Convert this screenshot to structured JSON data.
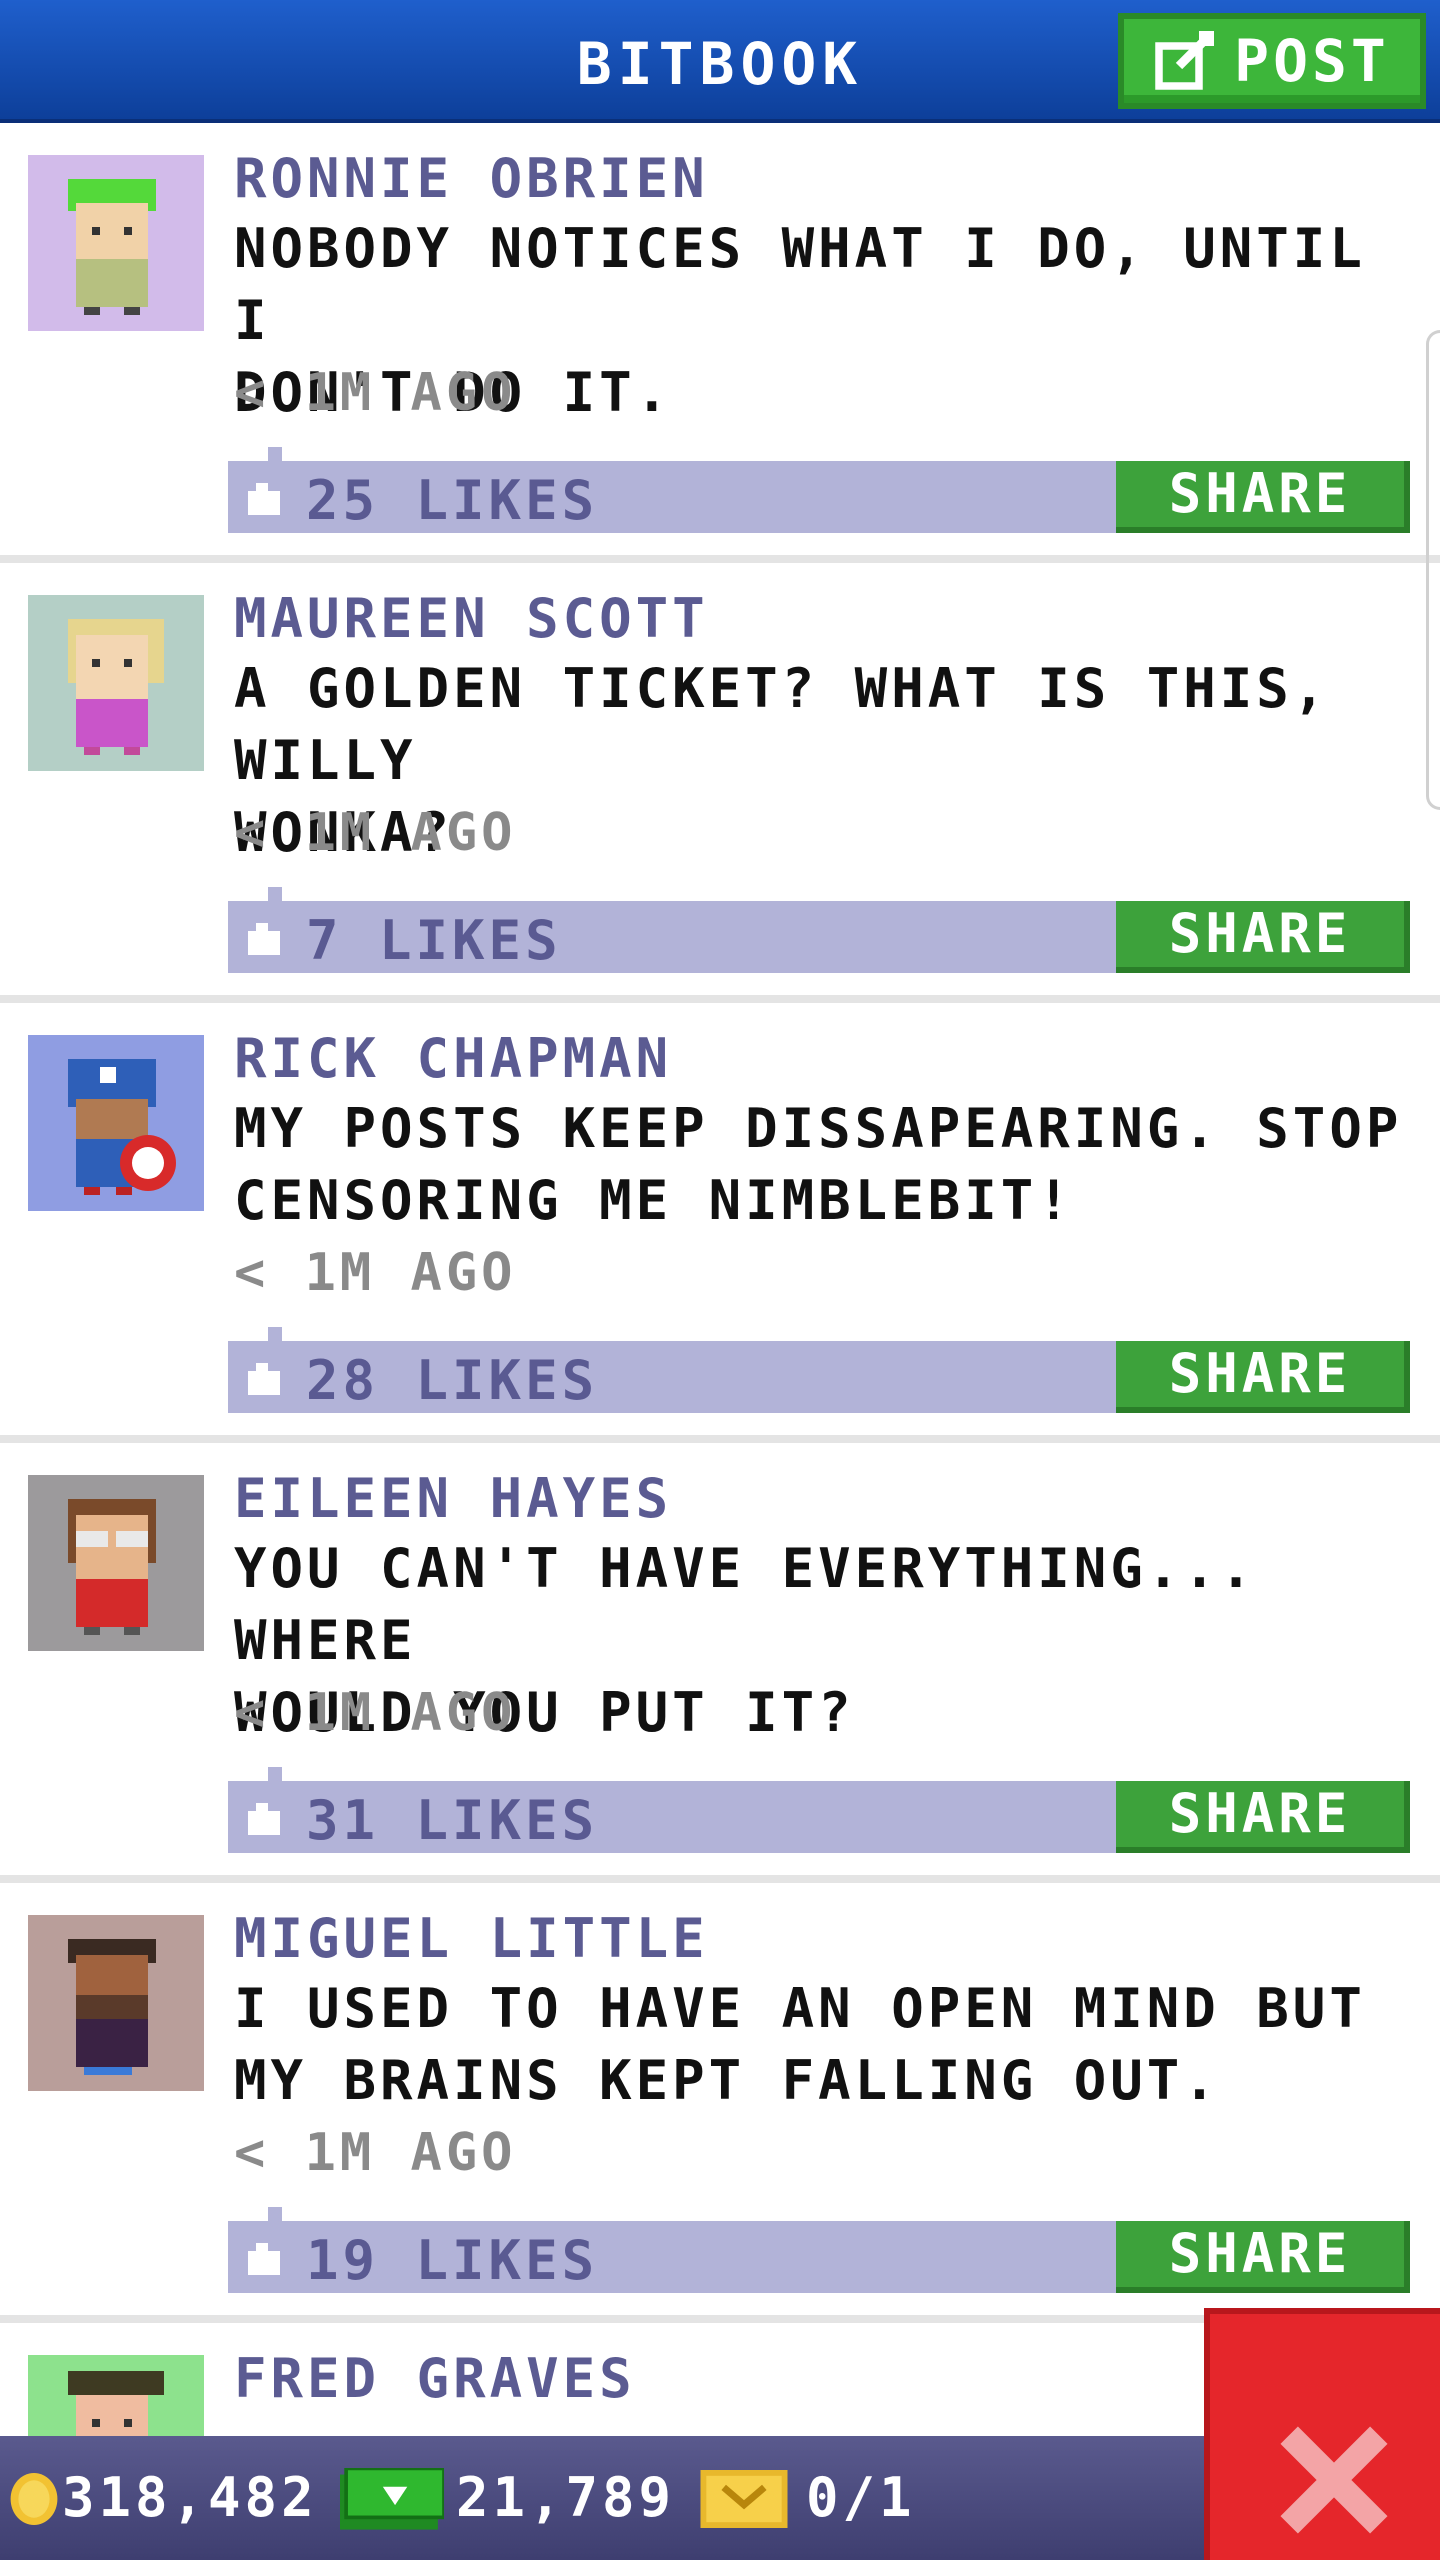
{
  "header": {
    "title": "BITBOOK",
    "post_label": "POST"
  },
  "posts": [
    {
      "author": "RONNIE OBRIEN",
      "line1": "NOBODY NOTICES WHAT I DO, UNTIL I",
      "line2": "DON'T DO IT.",
      "time": "< 1M AGO",
      "likes": "25 LIKES",
      "share": "SHARE",
      "avatar_bg": "#d2bbea"
    },
    {
      "author": "MAUREEN SCOTT",
      "line1": "A GOLDEN TICKET? WHAT IS THIS, WILLY",
      "line2": "WONKA?",
      "time": "< 1M AGO",
      "likes": "7 LIKES",
      "share": "SHARE",
      "avatar_bg": "#b4cfc6"
    },
    {
      "author": "RICK CHAPMAN",
      "line1": "MY POSTS KEEP DISSAPEARING. STOP",
      "line2": "CENSORING ME NIMBLEBIT!",
      "time": "< 1M AGO",
      "likes": "28 LIKES",
      "share": "SHARE",
      "avatar_bg": "#8f9de2"
    },
    {
      "author": "EILEEN HAYES",
      "line1": "YOU CAN'T HAVE EVERYTHING... WHERE",
      "line2": "WOULD YOU PUT IT?",
      "time": "< 1M AGO",
      "likes": "31 LIKES",
      "share": "SHARE",
      "avatar_bg": "#9c9a9c"
    },
    {
      "author": "MIGUEL LITTLE",
      "line1": "I USED TO HAVE AN OPEN MIND BUT",
      "line2": "MY BRAINS KEPT FALLING OUT.",
      "time": "< 1M AGO",
      "likes": "19 LIKES",
      "share": "SHARE",
      "avatar_bg": "#b99e9a"
    },
    {
      "author": "FRED GRAVES",
      "line1": "",
      "line2": "",
      "time": "",
      "likes": "",
      "share": "",
      "avatar_bg": "#8de28d"
    }
  ],
  "status": {
    "coins": "318,482",
    "bux": "21,789",
    "tickets": "0/1"
  },
  "colors": {
    "header": "#1a56c2",
    "accent_green": "#3db63a",
    "likes_bar": "#b2b3d8",
    "close_red": "#e5262b"
  },
  "icons": [
    "edit-icon",
    "thumbs-up-icon",
    "coin-icon",
    "bux-icon",
    "ticket-icon",
    "close-icon"
  ]
}
